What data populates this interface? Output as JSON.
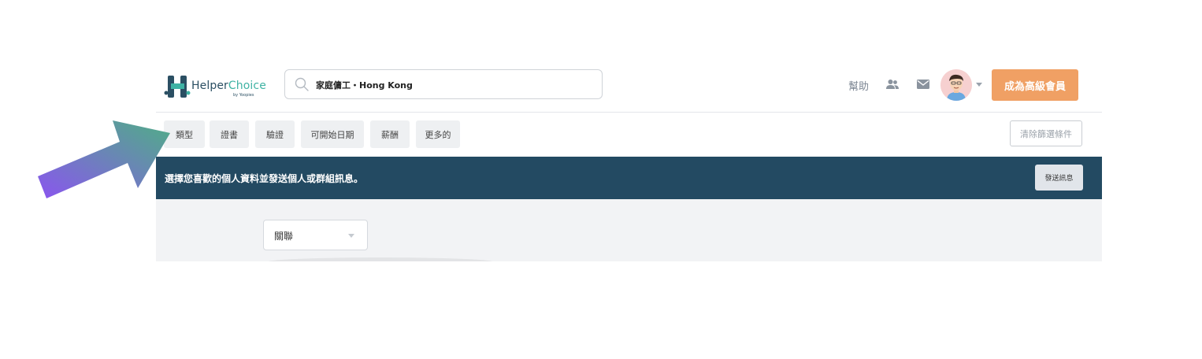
{
  "header": {
    "logo_text_main": "Helper",
    "logo_text_accent": "Choice",
    "logo_by": "by Yoopies",
    "search_value": "家庭傭工・Hong Kong",
    "help_label": "幫助",
    "premium_label": "成為高級會員"
  },
  "filters": {
    "items": [
      {
        "label": "類型"
      },
      {
        "label": "證書"
      },
      {
        "label": "驗證"
      },
      {
        "label": "可開始日期"
      },
      {
        "label": "薪酬"
      },
      {
        "label": "更多的"
      }
    ],
    "clear_label": "清除篩選條件"
  },
  "banner": {
    "text": "選擇您喜歡的個人資料並發送個人或群組訊息。",
    "send_label": "發送訊息"
  },
  "content": {
    "sort_value": "關聯"
  },
  "colors": {
    "banner": "#234a62",
    "premium": "#f0a064",
    "brand_teal": "#3fb3a4",
    "arrow_start": "#8a55ef",
    "arrow_end": "#4fae86"
  }
}
